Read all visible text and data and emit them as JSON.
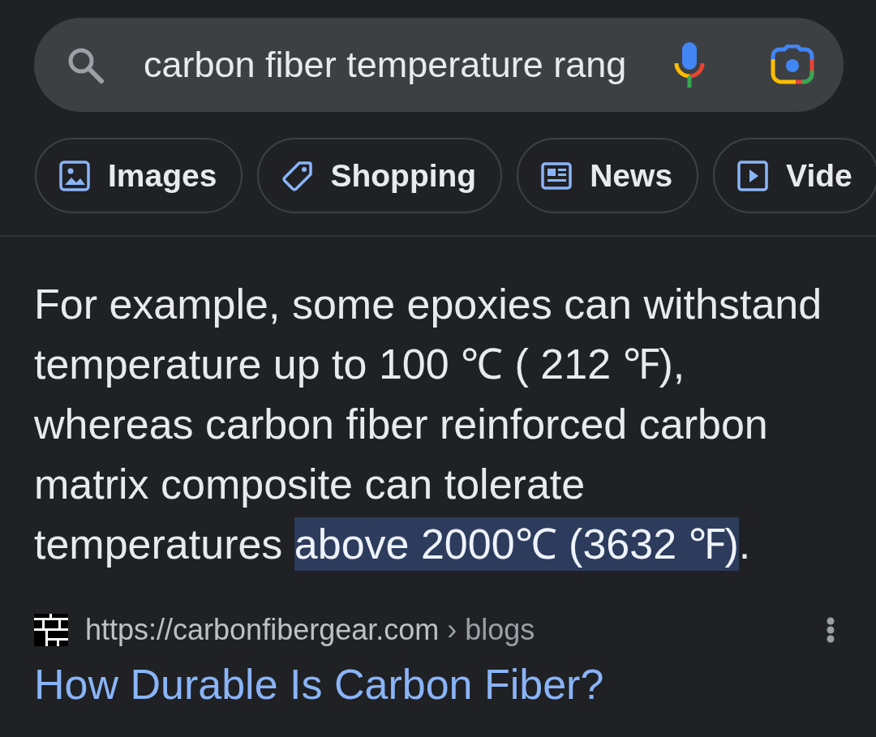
{
  "search_bar": {
    "query": "carbon fiber temperature rang"
  },
  "chips": [
    {
      "label": "Images",
      "kind": "images"
    },
    {
      "label": "Shopping",
      "kind": "shopping"
    },
    {
      "label": "News",
      "kind": "news"
    },
    {
      "label": "Vide",
      "kind": "videos"
    }
  ],
  "snippet": {
    "parts": [
      {
        "text": "For example, some epoxies can withstand temperature up to 100 ℃ ( 212 ℉), whereas carbon fiber reinforced carbon matrix composite can tolerate temperatures ",
        "highlighted": false
      },
      {
        "text": "above 2000℃ (3632 ℉)",
        "highlighted": true
      },
      {
        "text": ".",
        "highlighted": false
      }
    ]
  },
  "result": {
    "url": "https://carbonfibergear.com",
    "breadcrumb": "› blogs",
    "title": "How Durable Is Carbon Fiber?"
  }
}
